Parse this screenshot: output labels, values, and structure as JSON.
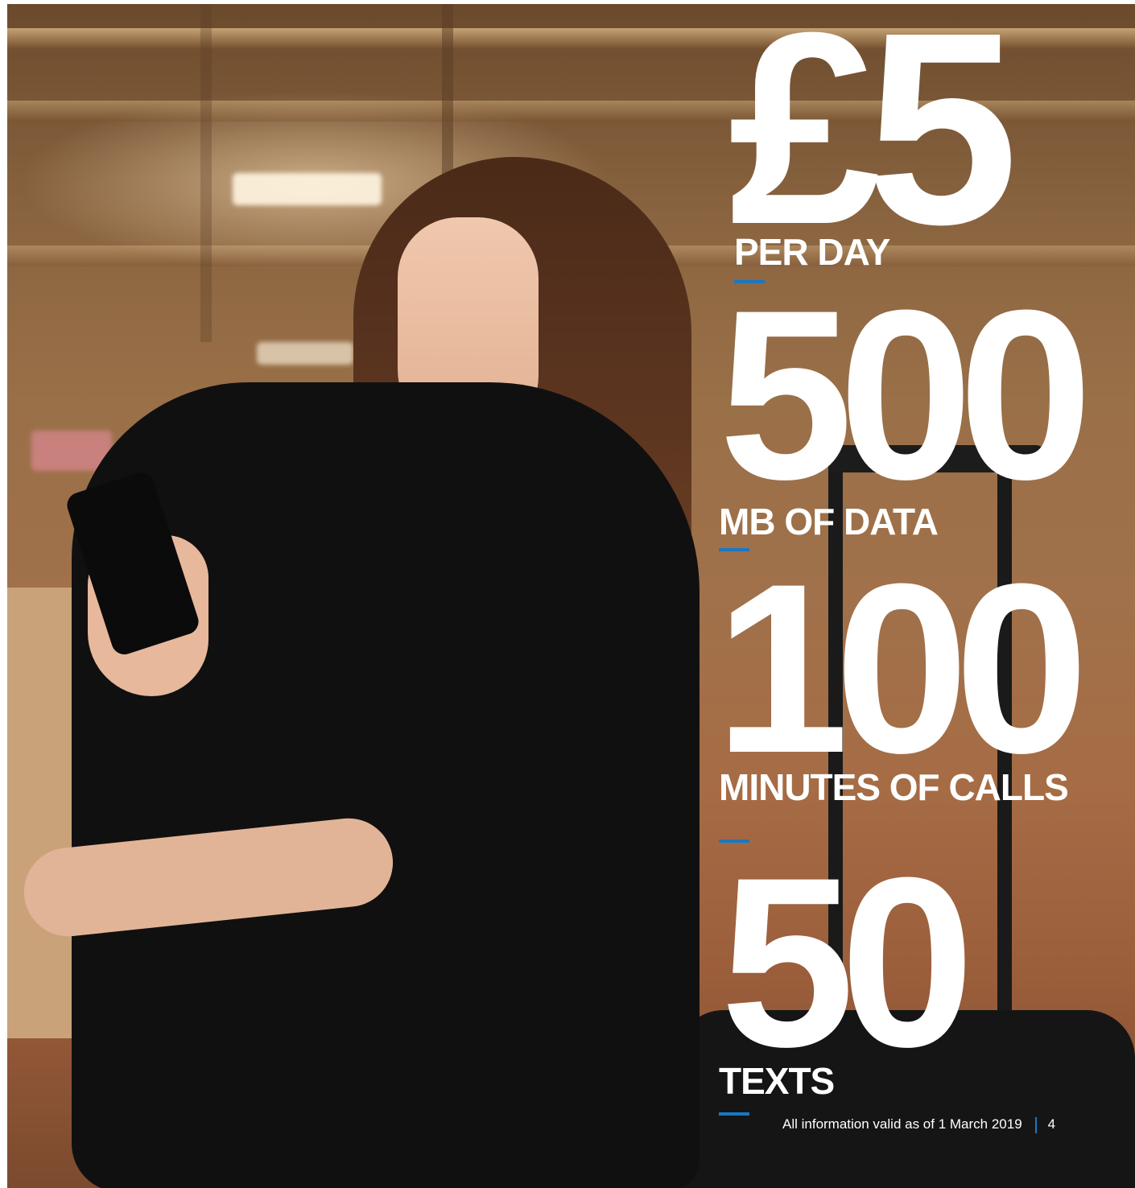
{
  "stats": [
    {
      "value": "£5",
      "label": "PER DAY"
    },
    {
      "value": "500",
      "label": "MB OF DATA"
    },
    {
      "value": "100",
      "label": "MINUTES OF CALLS"
    },
    {
      "value": "50",
      "label": "TEXTS"
    }
  ],
  "footer": {
    "text": "All information valid as of 1 March 2019",
    "page": "4"
  },
  "colors": {
    "accent": "#1a78c2",
    "text": "#ffffff"
  }
}
